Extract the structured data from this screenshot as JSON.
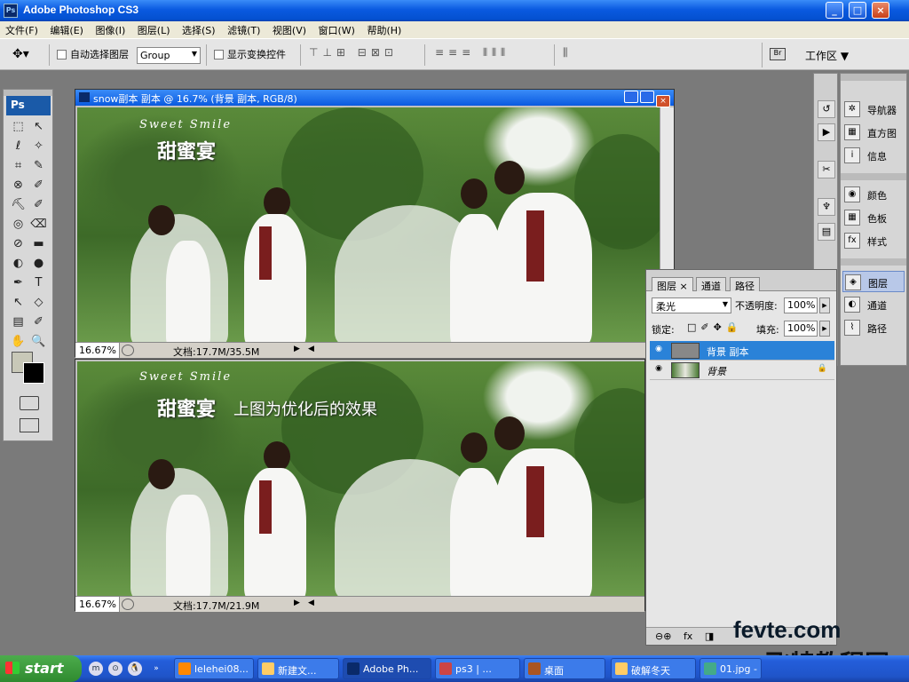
{
  "app": {
    "badge": "Ps",
    "title": "Adobe Photoshop CS3"
  },
  "window_buttons": {
    "minimize": "_",
    "maximize": "□",
    "close": "×"
  },
  "menu": [
    "文件(F)",
    "编辑(E)",
    "图像(I)",
    "图层(L)",
    "选择(S)",
    "滤镜(T)",
    "视图(V)",
    "窗口(W)",
    "帮助(H)"
  ],
  "options": {
    "auto_select_label": "自动选择图层",
    "auto_select_value": "Group",
    "show_transform_label": "显示变换控件",
    "align_icons_1": "⊤⊥⊞ ⊟⊠⊡",
    "align_icons_2": "≡≡≡ ⫴⫴⫴",
    "align_icons_3": "⫼",
    "workspace_label": "工作区 ▼"
  },
  "tools": {
    "badge": "Ps",
    "glyphs": [
      "⬚",
      "↖",
      "ℓ",
      "✧",
      "⌗",
      "✎",
      "⊗",
      "✐",
      "⛏",
      "✐",
      "◎",
      "⌫",
      "⊘",
      "▬",
      "◐",
      "●",
      "✒",
      "T",
      "↖",
      "◇",
      "▤",
      "✐",
      "✋",
      "🔍"
    ]
  },
  "doc1": {
    "title": "snow副本 副本 @ 16.7% (背景 副本, RGB/8)",
    "zoom": "16.67%",
    "doc_size": "文档:17.7M/35.5M",
    "logo_script": "Sweet Smile",
    "logo_name": "甜蜜宴"
  },
  "doc2": {
    "zoom": "16.67%",
    "doc_size": "文档:17.7M/21.9M",
    "logo_script": "Sweet Smile",
    "logo_name": "甜蜜宴",
    "caption": "上图为优化后的效果"
  },
  "dock_strip": [
    "↺",
    "▶",
    "✂",
    "♆",
    "▤"
  ],
  "dock_panels": [
    {
      "icon": "✲",
      "label": "导航器"
    },
    {
      "icon": "▦",
      "label": "直方图"
    },
    {
      "icon": "i",
      "label": "信息"
    },
    {
      "icon": "◉",
      "label": "颜色"
    },
    {
      "icon": "▦",
      "label": "色板"
    },
    {
      "icon": "fx",
      "label": "样式"
    },
    {
      "icon": "◈",
      "label": "图层"
    },
    {
      "icon": "◐",
      "label": "通道"
    },
    {
      "icon": "⌇",
      "label": "路径"
    }
  ],
  "layers_panel": {
    "tabs": [
      "图层 ×",
      "通道",
      "路径"
    ],
    "blend_mode": "柔光",
    "opacity_label": "不透明度:",
    "opacity": "100%",
    "lock_label": "锁定:",
    "lock_icons": "□✐✥🔒",
    "fill_label": "填充:",
    "fill": "100%",
    "layers": [
      {
        "name": "背景 副本",
        "selected": true
      },
      {
        "name": "背景",
        "selected": false
      }
    ],
    "footer_icons": [
      "⊖⊕",
      "fx",
      "◨",
      "⊘",
      "▭",
      "▢",
      "🗑"
    ]
  },
  "watermark": {
    "top": "fevte.com",
    "bottom": "飞特教程网"
  },
  "taskbar": {
    "start": "start",
    "quick_launch": [
      "m",
      "⊙",
      "🐧"
    ],
    "more": "»",
    "tasks": [
      "lelehei08...",
      "新建文...",
      "Adobe Ph...",
      "ps3 | ...",
      "桌面",
      "破解冬天",
      "01.jpg - ..."
    ]
  }
}
